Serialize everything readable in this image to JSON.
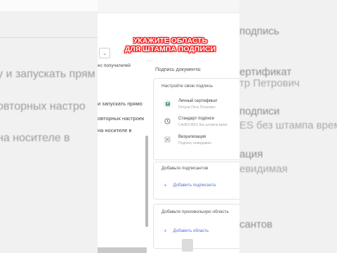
{
  "overlay": {
    "line1": "УКАЖИТЕ ОБЛАСТЬ",
    "line2": "ДЛЯ ШТАМПА ПОДПИСИ"
  },
  "background_left": {
    "lines": [
      "у и запускать прям",
      "овторных настро",
      "на носителе в"
    ]
  },
  "background_right": {
    "lines": [
      "подпись",
      "ертификат",
      "тр Петрович",
      "подписи",
      "ES без штампа врем",
      "ация",
      "евидимая",
      "сантов"
    ]
  },
  "document": {
    "lines": [
      "ес получателей",
      "и запускать прямо",
      "овторных настроек",
      "на носителе в"
    ]
  },
  "panel": {
    "title": "Подпись документа:",
    "setup_card": {
      "title": "Настройте свою подпись",
      "items": [
        {
          "icon": "certificate-icon",
          "label": "Личный сертификат",
          "sub": "Петров Петр Петрович"
        },
        {
          "icon": "clock-icon",
          "label": "Стандарт подписи",
          "sub": "CAdES-BES без штампа врем"
        },
        {
          "icon": "visualization-icon",
          "label": "Визуализация",
          "sub": "Подпись невидимая"
        }
      ]
    },
    "signers_card": {
      "title": "Добавьте подписантов",
      "add_label": "Добавить подписанта"
    },
    "area_card": {
      "title": "Добавьте произвольную область",
      "add_label": "Добавить область"
    }
  },
  "toolbar": {
    "select_caret": "⌄"
  },
  "colors": {
    "accent": "#4d76d6",
    "overlay_glow": "#ff1e1e",
    "cert_icon": "#4f9a78"
  }
}
